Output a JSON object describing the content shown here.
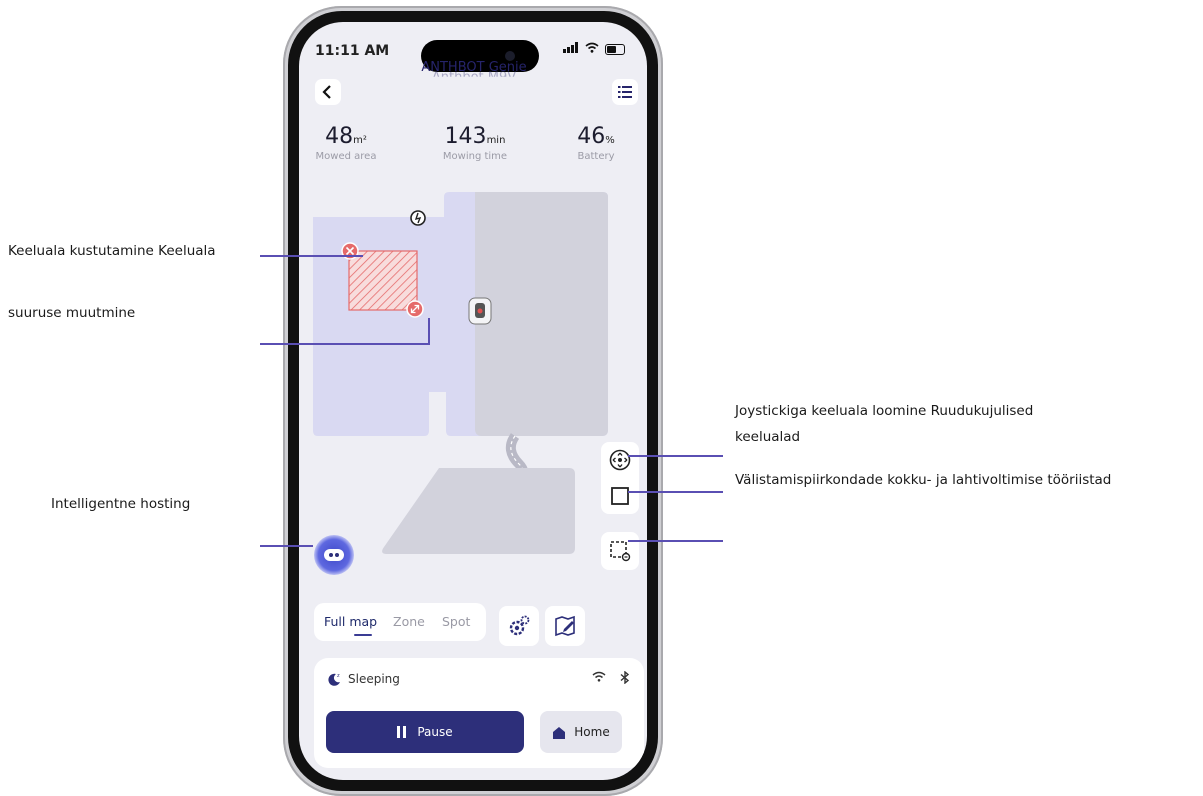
{
  "annotations": {
    "delete_zone": "Keeluala kustutamine Keeluala",
    "resize_zone": "suuruse muutmine",
    "hosting": "Intelligentne hosting",
    "joystick_line1": "Joystickiga keeluala loomine Ruudukujulised",
    "joystick_line2": "keelualad",
    "fold_tools": "Välistamispiirkondade kokku- ja lahtivoltimise tööriistad"
  },
  "status_bar": {
    "time": "11:11 AM"
  },
  "header": {
    "title": "ANTHBOT Genie",
    "title_behind": "Anthbot M9V"
  },
  "stats": [
    {
      "value": "48",
      "unit": "m²",
      "label": "Mowed area"
    },
    {
      "value": "143",
      "unit": "min",
      "label": "Mowing time"
    },
    {
      "value": "46",
      "unit": "%",
      "label": "Battery"
    }
  ],
  "mode_tabs": [
    "Full map",
    "Zone",
    "Spot"
  ],
  "robot_status": "Sleeping",
  "buttons": {
    "pause": "Pause",
    "home": "Home"
  },
  "colors": {
    "accent": "#2d2f7a",
    "callout_line": "#5a4fb3",
    "map_lawn": "#d9d9f2",
    "map_gray": "#d2d2dc",
    "no_go_zone": "#e56a6a"
  },
  "icons": {
    "back": "chevron-left-icon",
    "menu": "list-icon",
    "delete": "close-circle-icon",
    "resize": "resize-handle-icon",
    "charging_station": "charging-station-icon",
    "mower": "mower-icon",
    "joystick": "joystick-icon",
    "square_zone": "square-icon",
    "fold_tools": "dashed-square-tool-icon",
    "hosting": "robot-face-icon",
    "settings": "gear-icon",
    "edit_map": "edit-map-icon",
    "sleep": "moon-icon",
    "wifi": "wifi-icon",
    "bluetooth": "bluetooth-icon"
  }
}
